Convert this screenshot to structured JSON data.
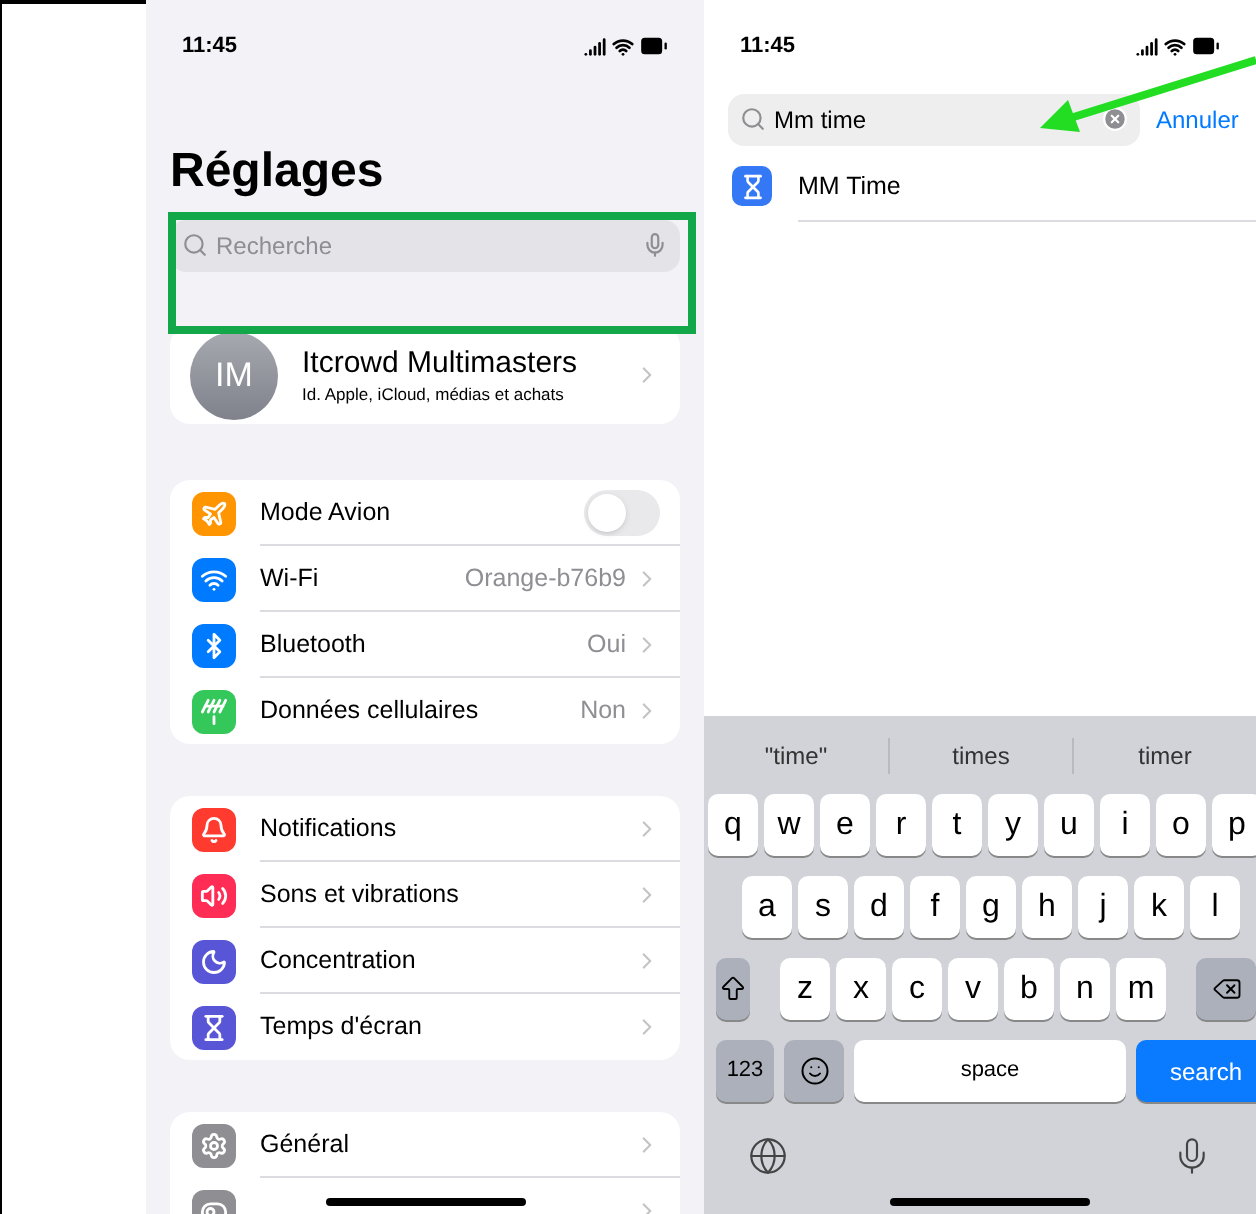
{
  "left_screen": {
    "status_bar": {
      "time": "11:45"
    },
    "title": "Réglages",
    "search": {
      "placeholder": "Recherche"
    },
    "profile": {
      "initials": "IM",
      "name": "Itcrowd Multimasters",
      "subtitle": "Id. Apple, iCloud, médias et achats"
    },
    "groups": [
      {
        "items": [
          {
            "kind": "toggle",
            "label": "Mode Avion",
            "color": "#ff9500",
            "on": false
          },
          {
            "kind": "link",
            "label": "Wi-Fi",
            "value": "Orange-b76b9",
            "color": "#007aff"
          },
          {
            "kind": "link",
            "label": "Bluetooth",
            "value": "Oui",
            "color": "#007aff"
          },
          {
            "kind": "link",
            "label": "Données cellulaires",
            "value": "Non",
            "color": "#34c759"
          }
        ]
      },
      {
        "items": [
          {
            "kind": "link",
            "label": "Notifications",
            "color": "#ff3b30"
          },
          {
            "kind": "link",
            "label": "Sons et vibrations",
            "color": "#ff2d55"
          },
          {
            "kind": "link",
            "label": "Concentration",
            "color": "#5856d6"
          },
          {
            "kind": "link",
            "label": "Temps d'écran",
            "color": "#5856d6"
          }
        ]
      },
      {
        "items": [
          {
            "kind": "link",
            "label": "Général",
            "color": "#8e8e93"
          },
          {
            "kind": "link",
            "color": "#8e8e93"
          }
        ]
      }
    ]
  },
  "right_screen": {
    "status_bar": {
      "time": "11:45"
    },
    "search": {
      "value": "Mm time"
    },
    "cancel": "Annuler",
    "results": [
      {
        "label": "MM Time"
      }
    ],
    "keyboard": {
      "suggestions": [
        "\"time\"",
        "times",
        "timer"
      ],
      "rows": [
        [
          "q",
          "w",
          "e",
          "r",
          "t",
          "y",
          "u",
          "i",
          "o",
          "p"
        ],
        [
          "a",
          "s",
          "d",
          "f",
          "g",
          "h",
          "j",
          "k",
          "l"
        ],
        [
          "z",
          "x",
          "c",
          "v",
          "b",
          "n",
          "m"
        ]
      ],
      "numbers_key": "123",
      "space_key": "space",
      "action_key": "search"
    }
  }
}
